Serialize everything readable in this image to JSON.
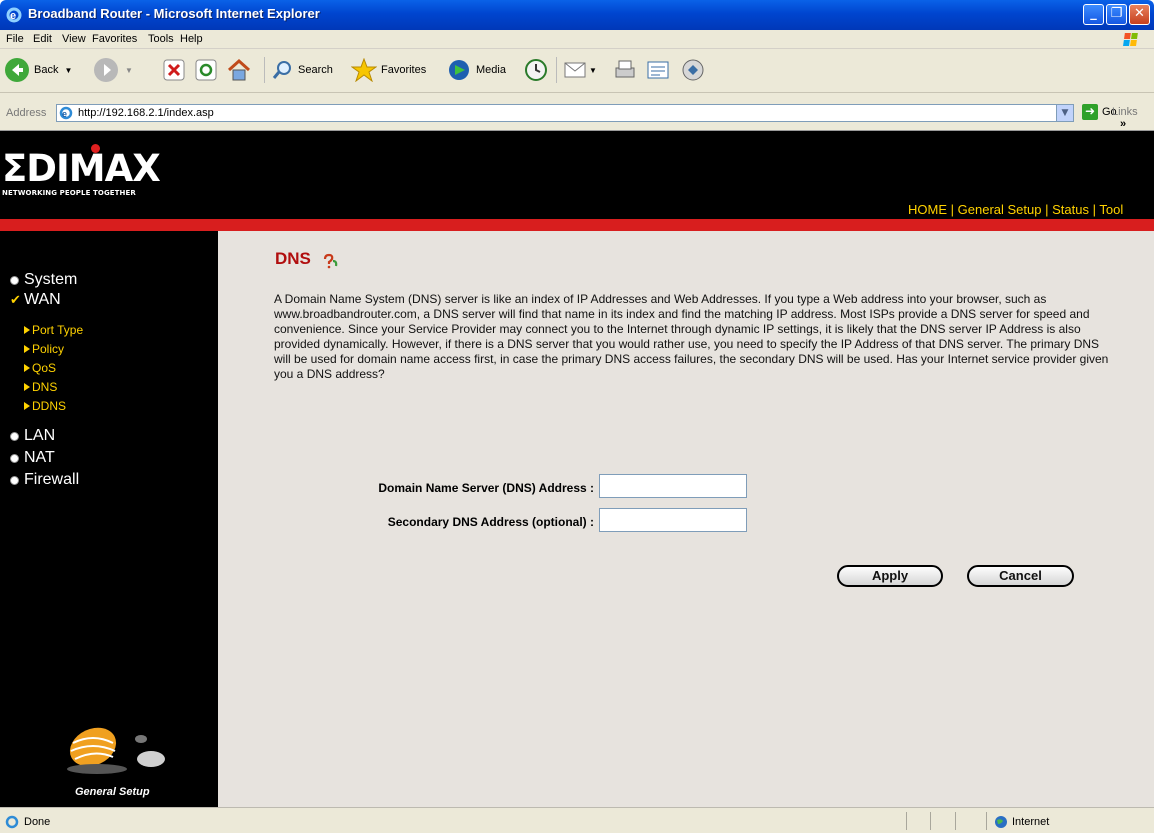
{
  "window": {
    "title": "Broadband Router - Microsoft Internet Explorer",
    "controls": {
      "minimize": "_",
      "maximize": "❐",
      "close": "✕"
    }
  },
  "menu": [
    "File",
    "Edit",
    "View",
    "Favorites",
    "Tools",
    "Help"
  ],
  "toolbar": {
    "back": "Back",
    "search": "Search",
    "favorites": "Favorites",
    "media": "Media"
  },
  "address": {
    "label": "Address",
    "url": "http://192.168.2.1/index.asp",
    "go": "Go",
    "links": "Links",
    "links_chevron": "»"
  },
  "brand": {
    "logo": "ΣDIMAX",
    "tagline": "NETWORKING PEOPLE TOGETHER"
  },
  "topnav": {
    "home": "HOME",
    "general_setup": "General Setup",
    "status": "Status",
    "tools": "Tool",
    "separator": "|"
  },
  "sidebar": {
    "items": {
      "system": "System",
      "wan": "WAN",
      "lan": "LAN",
      "nat": "NAT",
      "firewall": "Firewall"
    },
    "wan_sub": {
      "port_type": "Port Type",
      "policy": "Policy",
      "qos": "QoS",
      "dns": "DNS",
      "ddns": "DDNS"
    },
    "footer_label": "General Setup"
  },
  "main": {
    "title": "DNS",
    "description": "A Domain Name System (DNS) server is like an index of IP Addresses and Web Addresses. If you type a Web address into your browser, such as www.broadbandrouter.com, a DNS server will find that name in its index and find the matching IP address. Most ISPs provide a DNS server for speed and convenience. Since your Service Provider may connect you to the Internet through dynamic IP settings, it is likely that the DNS server IP Address is also provided dynamically. However, if there is a DNS server that you would rather use, you need to specify the IP Address of that DNS server. The primary DNS will be used for domain name access first, in case the primary DNS access failures, the secondary DNS will be used. Has your Internet service provider given you a DNS address?",
    "fields": {
      "primary_label": "Domain Name Server (DNS) Address :",
      "primary_value": "",
      "secondary_label": "Secondary DNS Address (optional) :",
      "secondary_value": ""
    },
    "buttons": {
      "apply": "Apply",
      "cancel": "Cancel"
    }
  },
  "statusbar": {
    "text": "Done",
    "zone": "Internet"
  },
  "colors": {
    "title_red": "#b10e0e",
    "nav_yellow": "#ffd200",
    "red_bar": "#d81e1e",
    "content_bg": "#e7e3de"
  }
}
